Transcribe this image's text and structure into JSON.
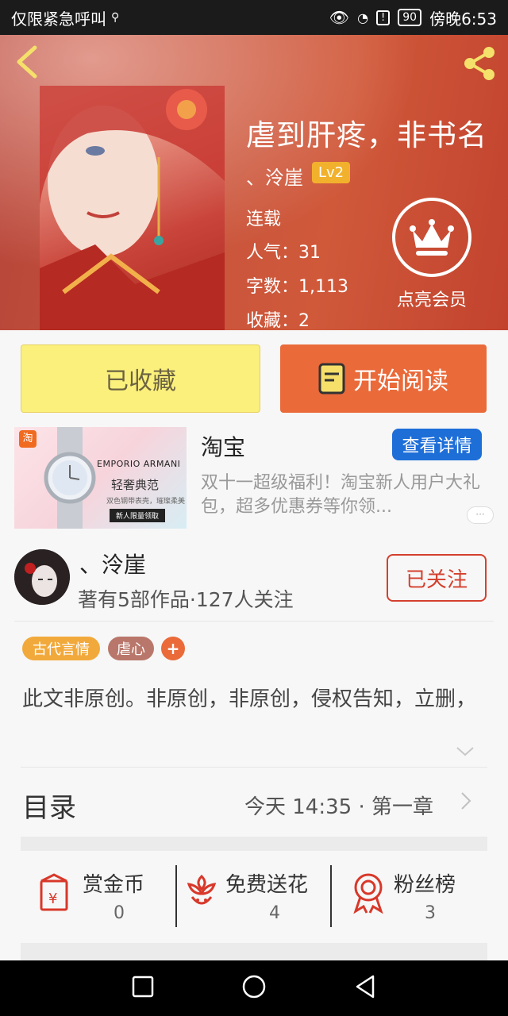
{
  "status_bar": {
    "left_text": "仅限紧急呼叫",
    "battery": "90",
    "time": "傍晚6:53"
  },
  "book": {
    "title": "虐到肝疼，非书名",
    "author": "、泠崖",
    "level": "Lv2",
    "status": "连载",
    "popularity": "人气：31",
    "word_count": "字数：1,113",
    "favorites": "收藏：2",
    "vip_label": "点亮会员"
  },
  "actions": {
    "favorited_label": "已收藏",
    "read_label": "开始阅读"
  },
  "ad": {
    "brand": "淘宝",
    "details_button": "查看详情",
    "description": "双十一超级福利！淘宝新人用户大礼包，超多优惠券等你领...",
    "image_badge": "淘",
    "image_brand": "EMPORIO ARMANI",
    "image_slogan": "轻奢典范",
    "image_subtext": "双色钢带表壳，璀璨柔美",
    "image_cta": "新人限量领取",
    "more": "···"
  },
  "author_card": {
    "name": "、泠崖",
    "meta": "著有5部作品·127人关注",
    "follow_label": "已关注"
  },
  "tags": [
    {
      "label": "古代言情",
      "color": "#f2a93b"
    },
    {
      "label": "虐心",
      "color": "#b9776b"
    },
    {
      "label": "+",
      "color": "#ea6a3a"
    }
  ],
  "synopsis": "此文非原创。非原创，非原创，侵权告知，立删，",
  "toc": {
    "title": "目录",
    "latest": "今天 14:35 · 第一章"
  },
  "stats": [
    {
      "label": "赏金币",
      "value": "0",
      "icon": "red-envelope-icon"
    },
    {
      "label": "免费送花",
      "value": "4",
      "icon": "flower-icon"
    },
    {
      "label": "粉丝榜",
      "value": "3",
      "icon": "medal-icon"
    }
  ],
  "colors": {
    "accent": "#ea6a3a",
    "follow_red": "#d4402e",
    "favorite_yellow": "#fbf07c",
    "ad_blue": "#1e6ed8"
  }
}
